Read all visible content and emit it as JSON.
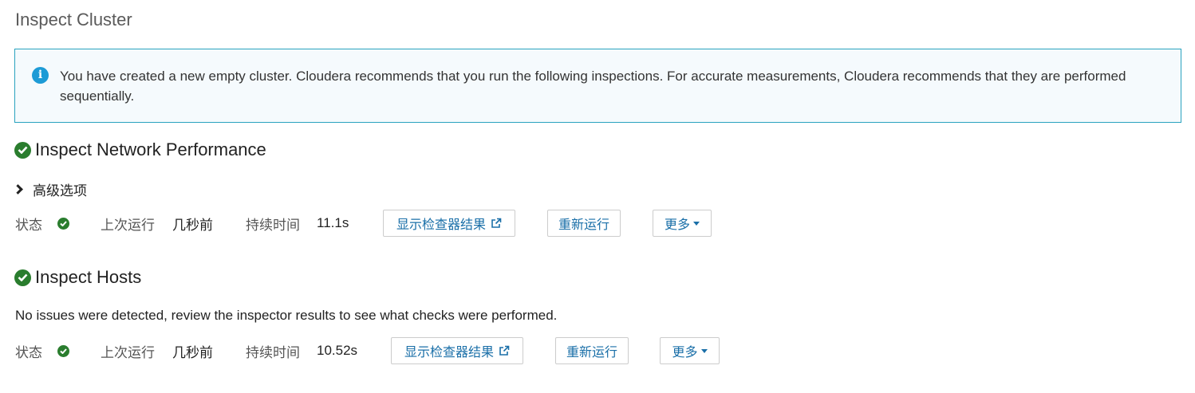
{
  "page": {
    "title": "Inspect Cluster"
  },
  "info": {
    "icon": "info-icon",
    "text": "You have created a new empty cluster. Cloudera recommends that you run the following inspections. For accurate measurements, Cloudera recommends that they are performed sequentially."
  },
  "sections": [
    {
      "title": "Inspect Network Performance",
      "advanced_label": "高级选项",
      "status_label": "状态",
      "last_run_label": "上次运行",
      "last_run_value": "几秒前",
      "duration_label": "持续时间",
      "duration_value": "11.1s",
      "show_results_label": "显示检查器结果",
      "rerun_label": "重新运行",
      "more_label": "更多"
    },
    {
      "title": "Inspect Hosts",
      "description": "No issues were detected, review the inspector results to see what checks were performed.",
      "status_label": "状态",
      "last_run_label": "上次运行",
      "last_run_value": "几秒前",
      "duration_label": "持续时间",
      "duration_value": "10.52s",
      "show_results_label": "显示检查器结果",
      "rerun_label": "重新运行",
      "more_label": "更多"
    }
  ],
  "colors": {
    "accent": "#1a6fa8",
    "success": "#2a7d2e",
    "info_border": "#2aa3bf",
    "info_bg": "#f5fafd"
  }
}
